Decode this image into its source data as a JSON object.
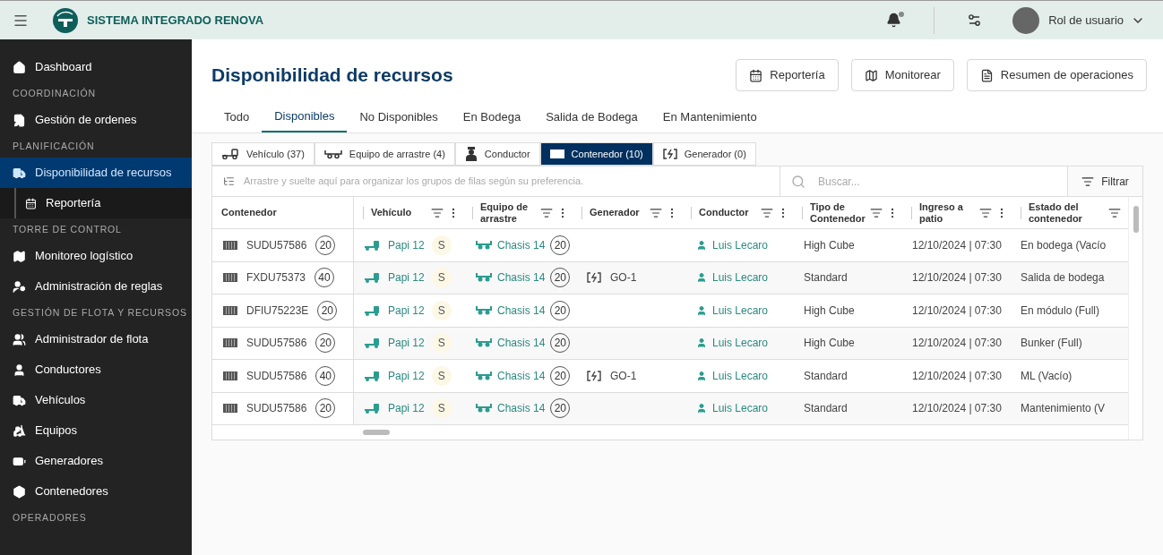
{
  "topbar": {
    "app_title": "SISTEMA INTEGRADO RENOVA",
    "notification_unread": true,
    "user_role": "Rol de usuario"
  },
  "sidebar": [
    {
      "kind": "link",
      "label": "Dashboard",
      "selected": false
    },
    {
      "kind": "heading",
      "label": "COORDINACIÓN"
    },
    {
      "kind": "link",
      "label": "Gestión de ordenes",
      "selected": false
    },
    {
      "kind": "heading",
      "label": "PLANIFICACIÓN"
    },
    {
      "kind": "link",
      "label": "Disponibilidad de recursos",
      "selected": true
    },
    {
      "kind": "sublink",
      "label": "Reportería",
      "selected": false
    },
    {
      "kind": "heading",
      "label": "TORRE DE CONTROL"
    },
    {
      "kind": "link",
      "label": "Monitoreo logístico",
      "selected": false
    },
    {
      "kind": "link",
      "label": "Administración de reglas",
      "selected": false
    },
    {
      "kind": "heading",
      "label": "GESTIÓN DE FLOTA Y RECURSOS"
    },
    {
      "kind": "link",
      "label": "Administrador de flota",
      "selected": false
    },
    {
      "kind": "link",
      "label": "Conductores",
      "selected": false
    },
    {
      "kind": "link",
      "label": "Vehículos",
      "selected": false
    },
    {
      "kind": "link",
      "label": "Equipos",
      "selected": false
    },
    {
      "kind": "link",
      "label": "Generadores",
      "selected": false
    },
    {
      "kind": "link",
      "label": "Contenedores",
      "selected": false
    },
    {
      "kind": "heading",
      "label": "OPERADORES"
    }
  ],
  "page": {
    "title": "Disponibilidad de recursos",
    "actions": [
      "Reportería",
      "Monitorear",
      "Resumen de operaciones"
    ],
    "tabs": [
      {
        "label": "Todo",
        "selected": false
      },
      {
        "label": "Disponibles",
        "selected": true
      },
      {
        "label": "No Disponibles",
        "selected": false
      },
      {
        "label": "En Bodega",
        "selected": false
      },
      {
        "label": "Salida de Bodega",
        "selected": false
      },
      {
        "label": "En Mantenimiento",
        "selected": false
      }
    ],
    "resource_tabs": [
      {
        "label": "Vehículo (37)",
        "selected": false
      },
      {
        "label": "Equipo de arrastre (4)",
        "selected": false
      },
      {
        "label": "Conductor",
        "selected": false
      },
      {
        "label": "Contenedor (10)",
        "selected": true
      },
      {
        "label": "Generador (0)",
        "selected": false
      }
    ],
    "group_hint": "Arrastre y suelte aquí para organizar los grupos de filas según su preferencia.",
    "search": {
      "placeholder": "Buscar..."
    },
    "filter_button": "Filtrar"
  },
  "table": {
    "columns": [
      {
        "label": "Contenedor",
        "filter": false,
        "menu": false
      },
      {
        "label": "Vehículo",
        "filter": true,
        "menu": true
      },
      {
        "label": "Equipo de arrastre",
        "filter": true,
        "menu": true
      },
      {
        "label": "Generador",
        "filter": true,
        "menu": true
      },
      {
        "label": "Conductor",
        "filter": true,
        "menu": true
      },
      {
        "label": "Tipo de Contenedor",
        "filter": true,
        "menu": true
      },
      {
        "label": "Ingreso a patio",
        "filter": true,
        "menu": true
      },
      {
        "label": "Estado del contenedor",
        "filter": true,
        "menu": false
      }
    ],
    "rows": [
      {
        "container": "SUDU57586",
        "size": "20",
        "vehicle": "Papi 12",
        "vehicle_badge": "S",
        "equipment": "Chasis 14",
        "equipment_size": "20",
        "generator": null,
        "driver": "Luis Lecaro",
        "type": "High Cube",
        "entry": "12/10/2024 | 07:30",
        "status": "En bodega (Vacío"
      },
      {
        "container": "FXDU75373",
        "size": "40",
        "vehicle": "Papi 12",
        "vehicle_badge": "S",
        "equipment": "Chasis 14",
        "equipment_size": "20",
        "generator": "GO-1",
        "driver": "Luis Lecaro",
        "type": "Standard",
        "entry": "12/10/2024 | 07:30",
        "status": "Salida de bodega"
      },
      {
        "container": "DFIU75223E",
        "size": "20",
        "vehicle": "Papi 12",
        "vehicle_badge": "S",
        "equipment": "Chasis 14",
        "equipment_size": "20",
        "generator": null,
        "driver": "Luis Lecaro",
        "type": "High Cube",
        "entry": "12/10/2024 | 07:30",
        "status": "En módulo (Full)"
      },
      {
        "container": "SUDU57586",
        "size": "20",
        "vehicle": "Papi 12",
        "vehicle_badge": "S",
        "equipment": "Chasis 14",
        "equipment_size": "20",
        "generator": null,
        "driver": "Luis Lecaro",
        "type": "High Cube",
        "entry": "12/10/2024 | 07:30",
        "status": "Bunker (Full)"
      },
      {
        "container": "SUDU57586",
        "size": "40",
        "vehicle": "Papi 12",
        "vehicle_badge": "S",
        "equipment": "Chasis 14",
        "equipment_size": "20",
        "generator": "GO-1",
        "driver": "Luis Lecaro",
        "type": "Standard",
        "entry": "12/10/2024 | 07:30",
        "status": "ML (Vacío)"
      },
      {
        "container": "SUDU57586",
        "size": "20",
        "vehicle": "Papi 12",
        "vehicle_badge": "S",
        "equipment": "Chasis 14",
        "equipment_size": "20",
        "generator": null,
        "driver": "Luis Lecaro",
        "type": "Standard",
        "entry": "12/10/2024 | 07:30",
        "status": "Mantenimiento (V"
      }
    ]
  }
}
